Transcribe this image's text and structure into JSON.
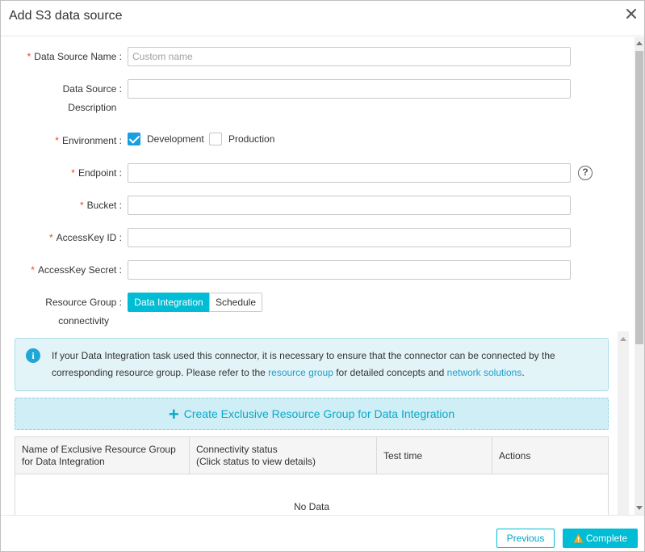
{
  "dialog": {
    "title": "Add S3 data source",
    "close_icon": "close-icon"
  },
  "form": {
    "name": {
      "label": "Data Source Name :",
      "required": true,
      "value": "",
      "placeholder": "Custom name"
    },
    "description": {
      "label_line1": "Data Source :",
      "label_line2": "Description",
      "value": ""
    },
    "environment": {
      "label": "Environment :",
      "required": true,
      "options": [
        {
          "label": "Development",
          "checked": true
        },
        {
          "label": "Production",
          "checked": false
        }
      ]
    },
    "endpoint": {
      "label": "Endpoint :",
      "required": true,
      "value": "",
      "help_icon": "question-circle-icon",
      "help_glyph": "?"
    },
    "bucket": {
      "label": "Bucket :",
      "required": true,
      "value": ""
    },
    "access_key_id": {
      "label": "AccessKey ID :",
      "required": true,
      "value": ""
    },
    "access_key_secret": {
      "label": "AccessKey Secret :",
      "required": true,
      "value": ""
    },
    "resource_group": {
      "label_line1": "Resource Group :",
      "label_line2": "connectivity",
      "tabs": [
        {
          "label": "Data Integration",
          "active": true
        },
        {
          "label": "Schedule",
          "active": false
        }
      ]
    }
  },
  "info": {
    "icon": "info-circle-icon",
    "icon_glyph": "i",
    "text_part1": "If your Data Integration task used this connector, it is necessary to ensure that the connector can be connected by the corresponding resource group. Please refer to the ",
    "link1": "resource group",
    "text_part2": " for detailed concepts and ",
    "link2": "network solutions",
    "text_part3": "."
  },
  "create_button": {
    "icon": "plus-icon",
    "icon_glyph": "+",
    "label": "Create Exclusive Resource Group for Data Integration"
  },
  "table": {
    "columns": [
      {
        "line1": "Name of Exclusive Resource Group",
        "line2": "for Data Integration"
      },
      {
        "line1": "Connectivity status",
        "line2": "(Click status to view details)"
      },
      {
        "line1": "Test time",
        "line2": ""
      },
      {
        "line1": "Actions",
        "line2": ""
      }
    ],
    "empty_text": "No Data"
  },
  "footer": {
    "previous_label": "Previous",
    "complete_label": "Complete",
    "complete_icon": "warning-icon"
  },
  "colors": {
    "accent": "#00bcd4",
    "checkbox": "#1b9ee0",
    "required": "#f04134",
    "link": "#1ca0c9",
    "warning": "#f5a623"
  }
}
